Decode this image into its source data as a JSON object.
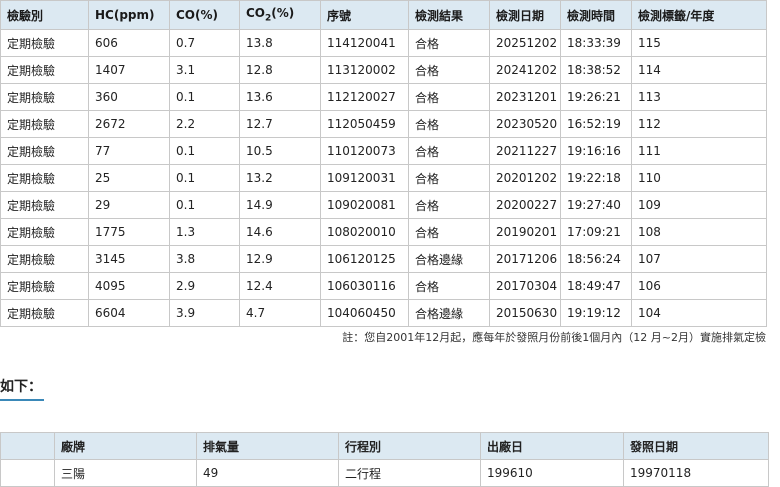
{
  "results": {
    "headers": [
      "檢驗別",
      "HC(ppm)",
      "CO(%)",
      "CO",
      "2",
      "(%)",
      "序號",
      "檢測結果",
      "檢測日期",
      "檢測時間",
      "檢測標籤/年度"
    ],
    "rows": [
      [
        "定期檢驗",
        "606",
        "0.7",
        "13.8",
        "114120041",
        "合格",
        "20251202",
        "18:33:39",
        "115"
      ],
      [
        "定期檢驗",
        "1407",
        "3.1",
        "12.8",
        "113120002",
        "合格",
        "20241202",
        "18:38:52",
        "114"
      ],
      [
        "定期檢驗",
        "360",
        "0.1",
        "13.6",
        "112120027",
        "合格",
        "20231201",
        "19:26:21",
        "113"
      ],
      [
        "定期檢驗",
        "2672",
        "2.2",
        "12.7",
        "112050459",
        "合格",
        "20230520",
        "16:52:19",
        "112"
      ],
      [
        "定期檢驗",
        "77",
        "0.1",
        "10.5",
        "110120073",
        "合格",
        "20211227",
        "19:16:16",
        "111"
      ],
      [
        "定期檢驗",
        "25",
        "0.1",
        "13.2",
        "109120031",
        "合格",
        "20201202",
        "19:22:18",
        "110"
      ],
      [
        "定期檢驗",
        "29",
        "0.1",
        "14.9",
        "109020081",
        "合格",
        "20200227",
        "19:27:40",
        "109"
      ],
      [
        "定期檢驗",
        "1775",
        "1.3",
        "14.6",
        "108020010",
        "合格",
        "20190201",
        "17:09:21",
        "108"
      ],
      [
        "定期檢驗",
        "3145",
        "3.8",
        "12.9",
        "106120125",
        "合格邊緣",
        "20171206",
        "18:56:24",
        "107"
      ],
      [
        "定期檢驗",
        "4095",
        "2.9",
        "12.4",
        "106030116",
        "合格",
        "20170304",
        "18:49:47",
        "106"
      ],
      [
        "定期檢驗",
        "6604",
        "3.9",
        "4.7",
        "104060450",
        "合格邊緣",
        "20150630",
        "19:19:12",
        "104"
      ]
    ]
  },
  "note": "註：您自2001年12月起，應每年於發照月份前後1個月內（12 月~2月）實施排氣定檢",
  "section_title": "如下：",
  "vehicle": {
    "headers": [
      "",
      "廠牌",
      "排氣量",
      "行程別",
      "出廠日",
      "發照日期"
    ],
    "row": [
      "",
      "三陽",
      "49",
      "二行程",
      "199610",
      "19970118"
    ]
  }
}
